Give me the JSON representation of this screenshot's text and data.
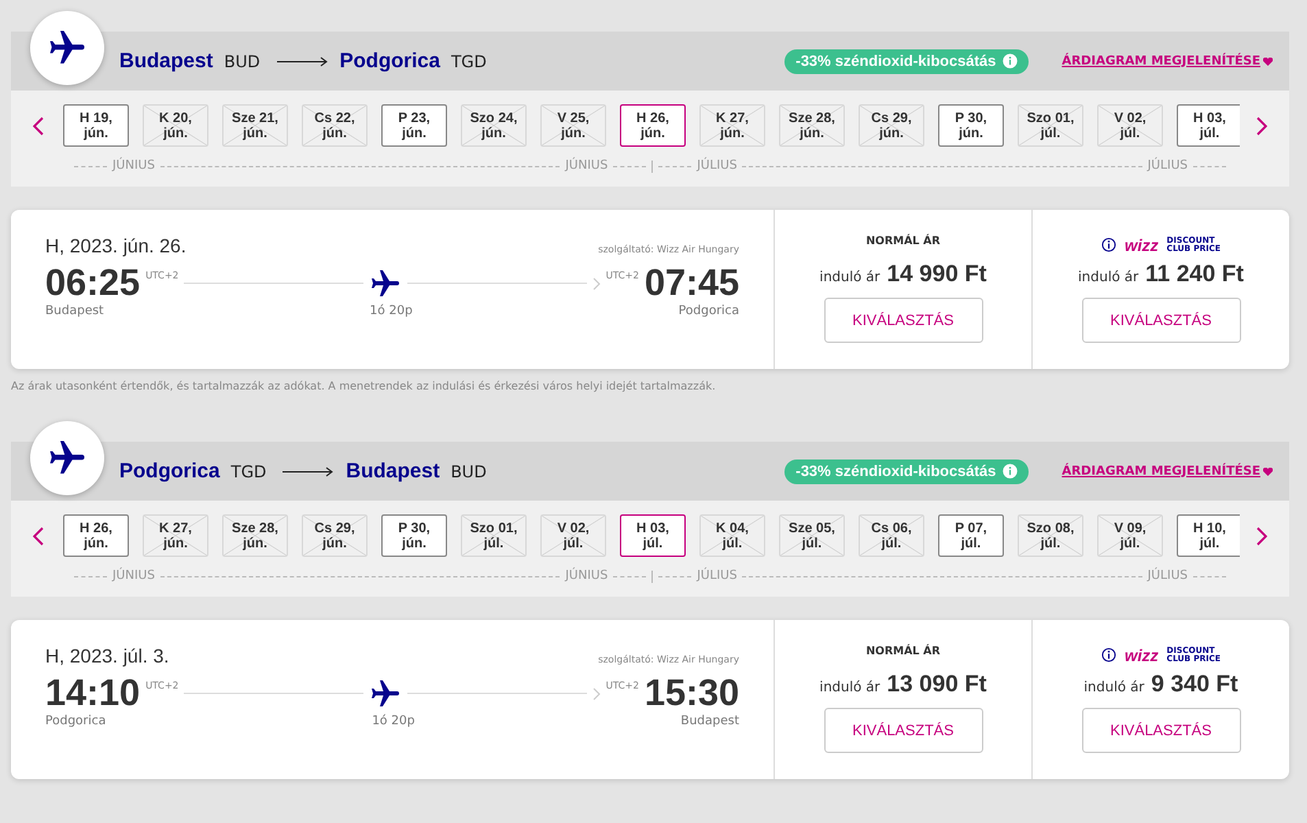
{
  "legs": [
    {
      "origin": {
        "city": "Budapest",
        "code": "BUD"
      },
      "destination": {
        "city": "Podgorica",
        "code": "TGD"
      },
      "co2_badge": "-33% széndioxid-kibocsátás",
      "chart_link": "ÁRDIAGRAM MEGJELENÍTÉSE",
      "dates": [
        {
          "label": "H 19, jún.",
          "available": true,
          "selected": false
        },
        {
          "label": "K 20, jún.",
          "available": false,
          "selected": false
        },
        {
          "label": "Sze 21, jún.",
          "available": false,
          "selected": false
        },
        {
          "label": "Cs 22, jún.",
          "available": false,
          "selected": false
        },
        {
          "label": "P 23, jún.",
          "available": true,
          "selected": false
        },
        {
          "label": "Szo 24, jún.",
          "available": false,
          "selected": false
        },
        {
          "label": "V 25, jún.",
          "available": false,
          "selected": false
        },
        {
          "label": "H 26, jún.",
          "available": true,
          "selected": true
        },
        {
          "label": "K 27, jún.",
          "available": false,
          "selected": false
        },
        {
          "label": "Sze 28, jún.",
          "available": false,
          "selected": false
        },
        {
          "label": "Cs 29, jún.",
          "available": false,
          "selected": false
        },
        {
          "label": "P 30, jún.",
          "available": true,
          "selected": false
        },
        {
          "label": "Szo 01, júl.",
          "available": false,
          "selected": false
        },
        {
          "label": "V 02, júl.",
          "available": false,
          "selected": false
        },
        {
          "label": "H 03, júl.",
          "available": true,
          "selected": false
        }
      ],
      "months": [
        {
          "label": "JÚNIUS",
          "kind": "start"
        },
        {
          "label": "JÚNIUS",
          "kind": "end"
        },
        {
          "label": "JÚLIUS",
          "kind": "start"
        },
        {
          "label": "JÚLIUS",
          "kind": "end"
        }
      ],
      "flight": {
        "date": "H, 2023. jún. 26.",
        "operator": "szolgáltató: Wizz Air Hungary",
        "departure_time": "06:25",
        "departure_tz": "UTC+2",
        "departure_city": "Budapest",
        "arrival_time": "07:45",
        "arrival_tz": "UTC+2",
        "arrival_city": "Podgorica",
        "duration": "1ó 20p"
      },
      "fares": [
        {
          "kind": "normal",
          "title": "NORMÁL ÁR",
          "from": "induló ár",
          "price": "14 990 Ft",
          "button": "KIVÁLASZTÁS"
        },
        {
          "kind": "club",
          "logo": "wizz",
          "logo_lines": [
            "DISCOUNT",
            "CLUB PRICE"
          ],
          "from": "induló ár",
          "price": "11 240 Ft",
          "button": "KIVÁLASZTÁS"
        }
      ],
      "note": "Az árak utasonként értendők, és tartalmazzák az adókat. A menetrendek az indulási és érkezési város helyi idejét tartalmazzák."
    },
    {
      "origin": {
        "city": "Podgorica",
        "code": "TGD"
      },
      "destination": {
        "city": "Budapest",
        "code": "BUD"
      },
      "co2_badge": "-33% széndioxid-kibocsátás",
      "chart_link": "ÁRDIAGRAM MEGJELENÍTÉSE",
      "dates": [
        {
          "label": "H 26, jún.",
          "available": true,
          "selected": false
        },
        {
          "label": "K 27, jún.",
          "available": false,
          "selected": false
        },
        {
          "label": "Sze 28, jún.",
          "available": false,
          "selected": false
        },
        {
          "label": "Cs 29, jún.",
          "available": false,
          "selected": false
        },
        {
          "label": "P 30, jún.",
          "available": true,
          "selected": false
        },
        {
          "label": "Szo 01, júl.",
          "available": false,
          "selected": false
        },
        {
          "label": "V 02, júl.",
          "available": false,
          "selected": false
        },
        {
          "label": "H 03, júl.",
          "available": true,
          "selected": true
        },
        {
          "label": "K 04, júl.",
          "available": false,
          "selected": false
        },
        {
          "label": "Sze 05, júl.",
          "available": false,
          "selected": false
        },
        {
          "label": "Cs 06, júl.",
          "available": false,
          "selected": false
        },
        {
          "label": "P 07, júl.",
          "available": true,
          "selected": false
        },
        {
          "label": "Szo 08, júl.",
          "available": false,
          "selected": false
        },
        {
          "label": "V 09, júl.",
          "available": false,
          "selected": false
        },
        {
          "label": "H 10, júl.",
          "available": true,
          "selected": false
        }
      ],
      "months": [
        {
          "label": "JÚNIUS",
          "kind": "start"
        },
        {
          "label": "JÚNIUS",
          "kind": "end"
        },
        {
          "label": "JÚLIUS",
          "kind": "start"
        },
        {
          "label": "JÚLIUS",
          "kind": "end"
        }
      ],
      "flight": {
        "date": "H, 2023. júl. 3.",
        "operator": "szolgáltató: Wizz Air Hungary",
        "departure_time": "14:10",
        "departure_tz": "UTC+2",
        "departure_city": "Podgorica",
        "arrival_time": "15:30",
        "arrival_tz": "UTC+2",
        "arrival_city": "Budapest",
        "duration": "1ó 20p"
      },
      "fares": [
        {
          "kind": "normal",
          "title": "NORMÁL ÁR",
          "from": "induló ár",
          "price": "13 090 Ft",
          "button": "KIVÁLASZTÁS"
        },
        {
          "kind": "club",
          "logo": "wizz",
          "logo_lines": [
            "DISCOUNT",
            "CLUB PRICE"
          ],
          "from": "induló ár",
          "price": "9 340 Ft",
          "button": "KIVÁLASZTÁS"
        }
      ]
    }
  ]
}
